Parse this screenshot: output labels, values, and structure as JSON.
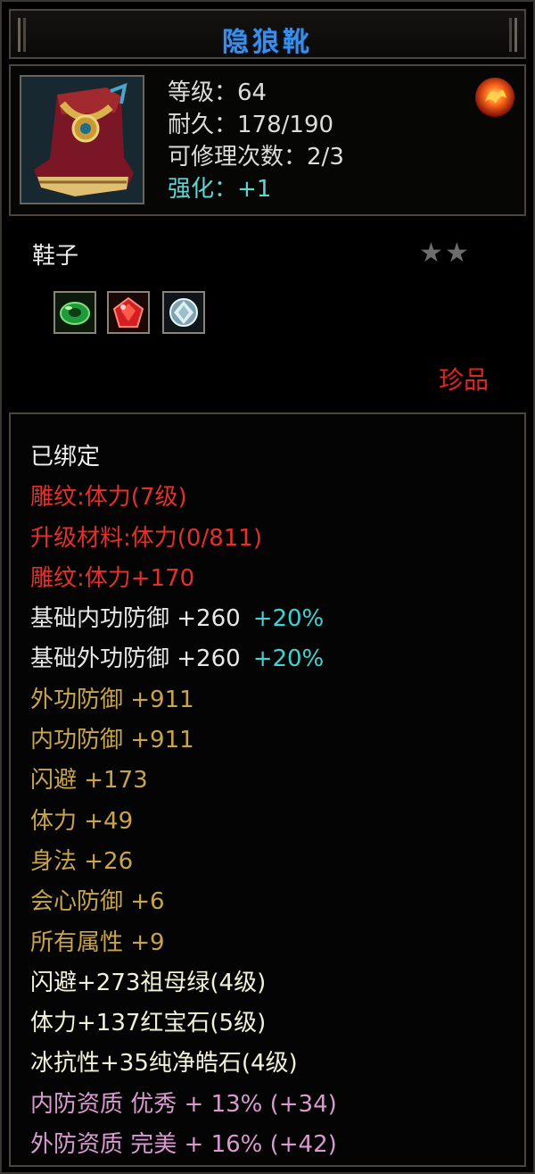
{
  "item": {
    "name": "隐狼靴",
    "stats": [
      {
        "label": "等级：",
        "value": "64",
        "style": "normal"
      },
      {
        "label": "耐久：",
        "value": "178/190",
        "style": "normal"
      },
      {
        "label": "可修理次数：",
        "value": "2/3",
        "style": "normal"
      },
      {
        "label": "强化：",
        "value": "+1",
        "style": "enhance"
      }
    ],
    "type": "鞋子",
    "star_count": 2,
    "stars_max": 2,
    "rarity": "珍品",
    "gems": [
      {
        "icon": "green-jade-gem-icon",
        "color": "#1f9a3a"
      },
      {
        "icon": "red-ruby-gem-icon",
        "color": "#d21f22"
      },
      {
        "icon": "white-diamond-gem-icon",
        "color": "#cfe3e8"
      }
    ]
  },
  "attributes": [
    {
      "text": "已绑定",
      "color": "#f0f0f0"
    },
    {
      "text": "雕纹:体力(7级)",
      "color": "#e3302a"
    },
    {
      "text": "升级材料:体力(0/811)",
      "color": "#e3302a"
    },
    {
      "text": "雕纹:体力+170",
      "color": "#e3302a"
    },
    {
      "text": "基础内功防御  +260",
      "bonus": "+20%",
      "color": "#e8e8e8"
    },
    {
      "text": "基础外功防御  +260",
      "bonus": "+20%",
      "color": "#e8e8e8"
    },
    {
      "text": "外功防御  +911",
      "color": "#c9a44e"
    },
    {
      "text": "内功防御  +911",
      "color": "#c9a44e"
    },
    {
      "text": "闪避  +173",
      "color": "#c9a44e"
    },
    {
      "text": "体力  +49",
      "color": "#c9a44e"
    },
    {
      "text": "身法  +26",
      "color": "#c9a44e"
    },
    {
      "text": "会心防御  +6",
      "color": "#c9a44e"
    },
    {
      "text": "所有属性  +9",
      "color": "#c9a44e"
    },
    {
      "text": "闪避+273祖母绿(4级)",
      "color": "#f2f2d8"
    },
    {
      "text": "体力+137红宝石(5级)",
      "color": "#f2f2d8"
    },
    {
      "text": "冰抗性+35纯净皓石(4级)",
      "color": "#f2f2d8"
    },
    {
      "text": "内防资质  优秀  + 13% (+34)",
      "color": "#d99ad0"
    },
    {
      "text": "外防资质  完美  + 16% (+42)",
      "color": "#d99ad0"
    }
  ],
  "colors": {
    "title": "#3b8ee8",
    "enhance": "#5fd6d6",
    "rarity": "#e0261f",
    "border": "#4a453e"
  },
  "icons": {
    "item": "boots-icon",
    "orb": "fire-orb-icon",
    "star": "star-icon"
  }
}
